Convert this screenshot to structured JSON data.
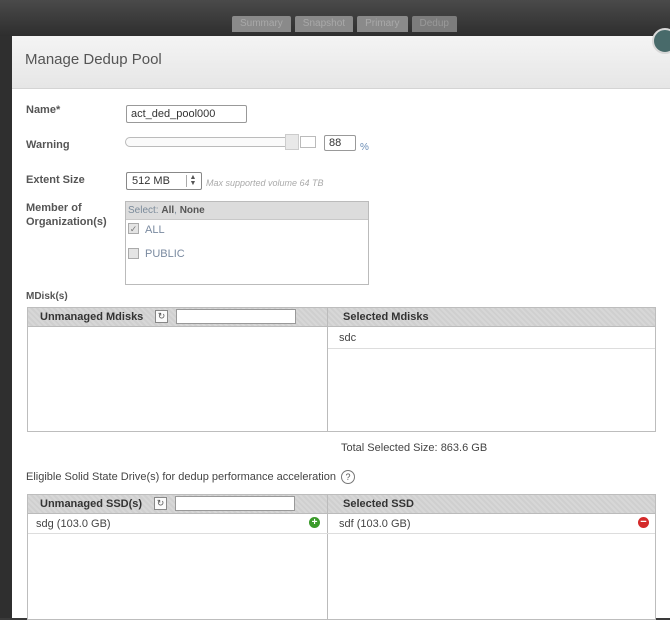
{
  "nav": {
    "tabs": [
      "Summary",
      "Snapshot",
      "Primary",
      "Dedup"
    ]
  },
  "dialog": {
    "title": "Manage Dedup Pool"
  },
  "form": {
    "name_label": "Name*",
    "name_value": "act_ded_pool000",
    "warning_label": "Warning",
    "warning_value": "88",
    "warning_unit": "%",
    "warning_level_percent": 88,
    "extent_label": "Extent Size",
    "extent_value": "512 MB",
    "extent_hint": "Max supported volume 64 TB",
    "member_label_1": "Member of",
    "member_label_2": "Organization(s)",
    "org_select_prefix": "Select:",
    "org_select_all": "All",
    "org_select_sep": ",",
    "org_select_none": "None",
    "orgs": [
      {
        "label": "ALL",
        "checked": true
      },
      {
        "label": "PUBLIC",
        "checked": false
      }
    ]
  },
  "mdisks": {
    "section_label": "MDisk(s)",
    "unmanaged_title": "Unmanaged Mdisks",
    "selected_title": "Selected Mdisks",
    "selected_items": [
      "sdc"
    ],
    "total_label": "Total Selected Size:",
    "total_value": "863.6 GB"
  },
  "ssd": {
    "section_label": "Eligible Solid State Drive(s) for dedup performance acceleration",
    "help_glyph": "?",
    "unmanaged_title": "Unmanaged SSD(s)",
    "selected_title": "Selected SSD",
    "unmanaged_items": [
      "sdg (103.0 GB)"
    ],
    "selected_items": [
      "sdf (103.0 GB)"
    ]
  },
  "icons": {
    "refresh": "refresh-icon",
    "add": "add-icon",
    "remove": "remove-icon",
    "help": "help-icon",
    "check": "✓"
  },
  "colors": {
    "add": "#3a9a2a",
    "remove": "#d42a2a",
    "close": "#486a6a"
  }
}
